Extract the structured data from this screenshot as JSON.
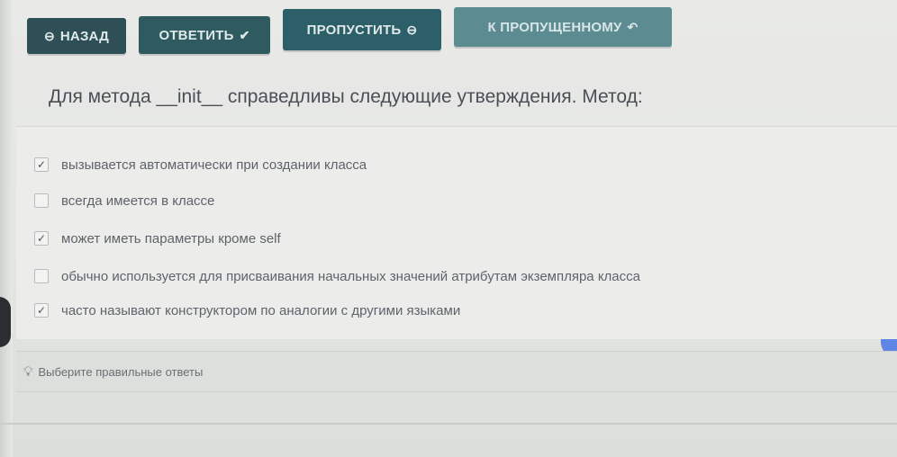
{
  "toolbar": {
    "back_label": "НАЗАД",
    "answer_label": "ОТВЕТИТЬ",
    "skip_label": "ПРОПУСТИТЬ",
    "to_skipped_label": "К ПРОПУЩЕННОМУ"
  },
  "question": {
    "text": "Для метода __init__ справедливы следующие утверждения. Метод:"
  },
  "options": [
    {
      "label": "вызывается автоматически при создании класса",
      "checked": true
    },
    {
      "label": "всегда имеется в классе",
      "checked": false
    },
    {
      "label": "может иметь параметры кроме self",
      "checked": true
    },
    {
      "label": "обычно используется для присваивания начальных значений атрибутам экземпляра класса",
      "checked": false
    },
    {
      "label": "часто называют конструктором по аналогии с другими языками",
      "checked": true
    }
  ],
  "hint": {
    "text": "Выберите правильные ответы"
  },
  "colors": {
    "button_dark": "#2f4f57",
    "button_light": "#5d8b92",
    "background": "#e4e6e4"
  }
}
